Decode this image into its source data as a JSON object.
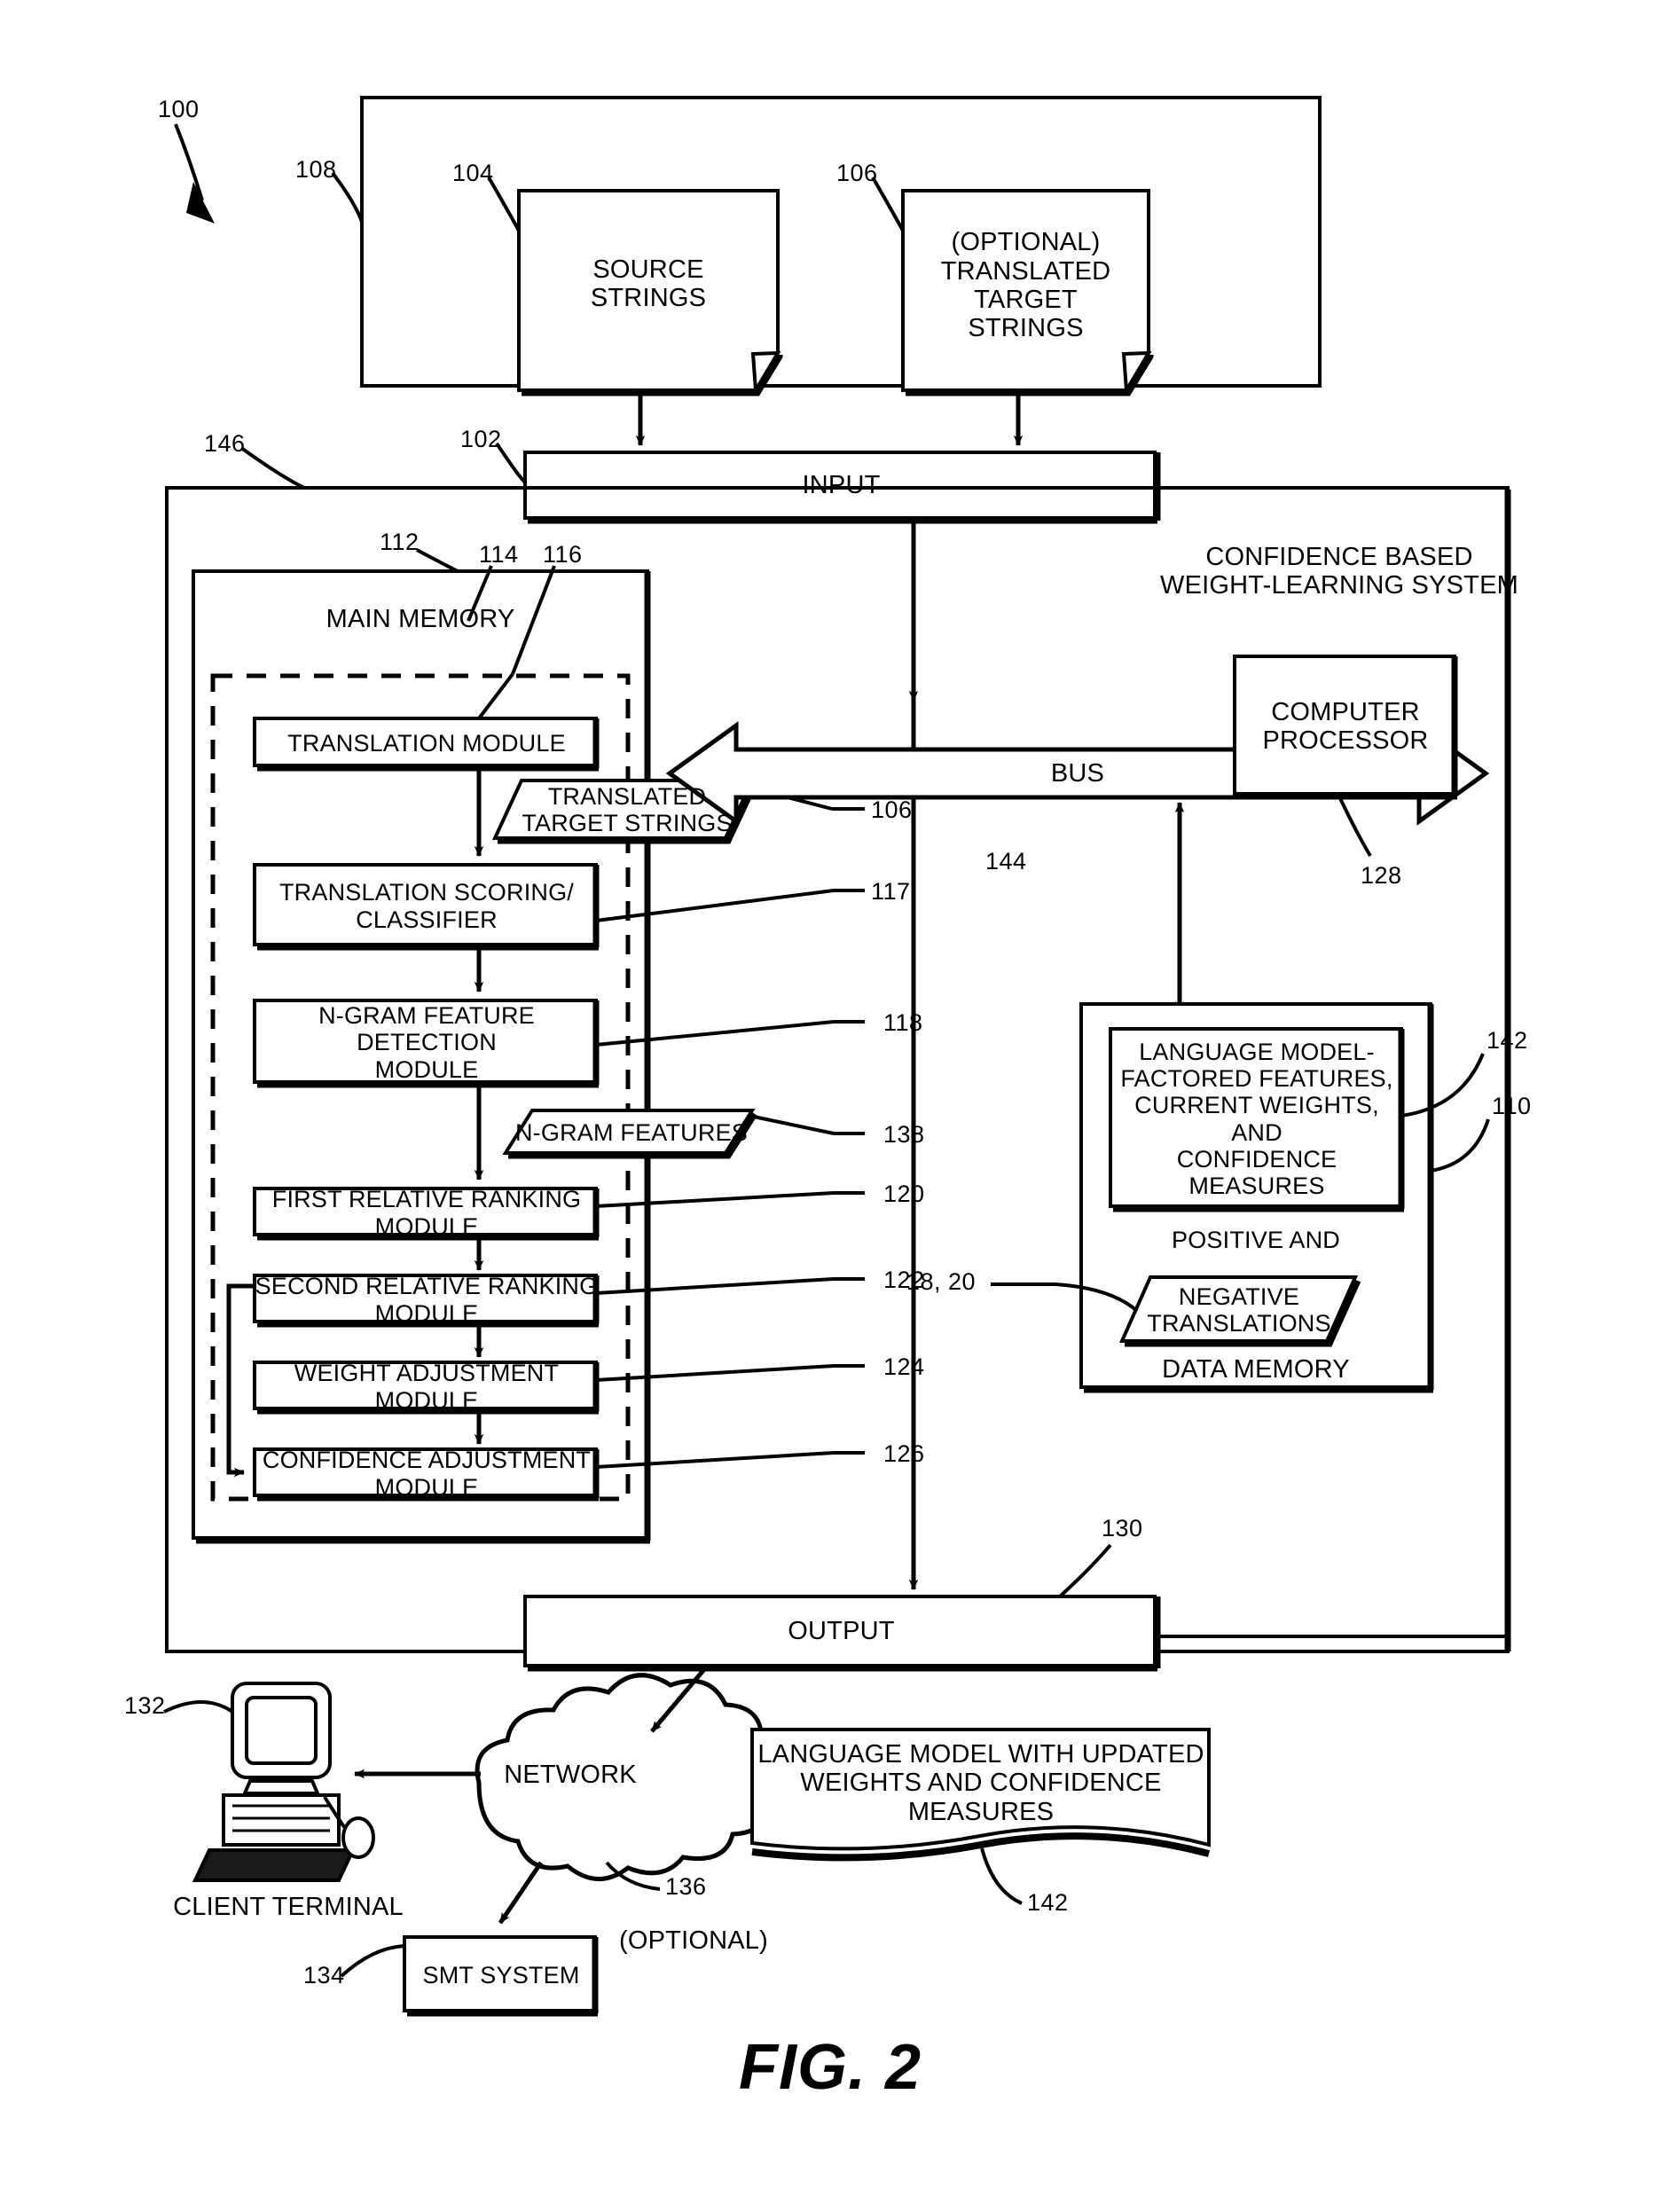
{
  "figure": {
    "label": "FIG. 2"
  },
  "top_section": {
    "ref": "108",
    "system_ref": "100",
    "documents": [
      {
        "ref": "104",
        "label": "SOURCE\nSTRINGS"
      },
      {
        "ref": "106",
        "label": "(OPTIONAL)\nTRANSLATED\nTARGET\nSTRINGS"
      }
    ]
  },
  "input": {
    "ref": "102",
    "label": "INPUT"
  },
  "system": {
    "ref": "146",
    "title": "CONFIDENCE BASED\nWEIGHT-LEARNING SYSTEM"
  },
  "main_memory": {
    "ref": "112",
    "label": "MAIN MEMORY",
    "inner_ref_a": "114",
    "inner_ref_b": "116",
    "modules": [
      {
        "ref": "116",
        "label": "TRANSLATION MODULE",
        "shape": "rect"
      },
      {
        "ref": "106",
        "label": "TRANSLATED\nTARGET STRINGS",
        "shape": "parallelogram"
      },
      {
        "ref": "117",
        "label": "TRANSLATION SCORING/\nCLASSIFIER",
        "shape": "rect"
      },
      {
        "ref": "118",
        "label": "N-GRAM FEATURE DETECTION\nMODULE",
        "shape": "rect"
      },
      {
        "ref": "138",
        "label": "N-GRAM FEATURES",
        "shape": "parallelogram"
      },
      {
        "ref": "120",
        "label": "FIRST RELATIVE RANKING MODULE",
        "shape": "rect"
      },
      {
        "ref": "122",
        "label": "SECOND RELATIVE RANKING MODULE",
        "shape": "rect"
      },
      {
        "ref": "124",
        "label": "WEIGHT ADJUSTMENT MODULE",
        "shape": "rect"
      },
      {
        "ref": "126",
        "label": "CONFIDENCE ADJUSTMENT MODULE",
        "shape": "rect"
      }
    ]
  },
  "bus": {
    "label": "BUS",
    "ref": "144"
  },
  "processor": {
    "ref": "128",
    "label": "COMPUTER\nPROCESSOR"
  },
  "data_memory": {
    "ref": "110",
    "label": "DATA MEMORY",
    "features_ref": "142",
    "features_label": "LANGUAGE MODEL-\nFACTORED FEATURES,\nCURRENT WEIGHTS, AND\nCONFIDENCE MEASURES",
    "positive_label": "POSITIVE AND",
    "translations_ref": "18, 20",
    "translations_label": "NEGATIVE\nTRANSLATIONS"
  },
  "output": {
    "ref": "130",
    "label": "OUTPUT"
  },
  "network": {
    "ref": "136",
    "label": "NETWORK",
    "optional_note": "(OPTIONAL)"
  },
  "client_terminal": {
    "ref": "132",
    "label": "CLIENT TERMINAL"
  },
  "smt_system": {
    "ref": "134",
    "label": "SMT SYSTEM"
  },
  "language_model_out": {
    "ref": "142",
    "label": "LANGUAGE MODEL WITH UPDATED\nWEIGHTS AND CONFIDENCE MEASURES"
  }
}
